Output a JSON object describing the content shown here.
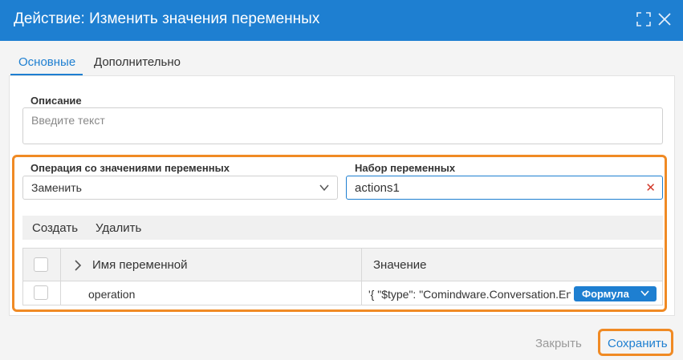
{
  "dialog": {
    "title": "Действие: Изменить значения переменных"
  },
  "tabs": [
    {
      "label": "Основные",
      "active": true
    },
    {
      "label": "Дополнительно",
      "active": false
    }
  ],
  "description": {
    "label": "Описание",
    "placeholder": "Введите текст",
    "value": ""
  },
  "operation": {
    "label": "Операция со значениями переменных",
    "selected": "Заменить"
  },
  "variable_set": {
    "label": "Набор переменных",
    "value": "actions1"
  },
  "toolbar": {
    "create_label": "Создать",
    "delete_label": "Удалить"
  },
  "table": {
    "columns": [
      "Имя переменной",
      "Значение"
    ],
    "rows": [
      {
        "name": "operation",
        "value": "'{ \"$type\": \"Comindware.Conversation.Ent",
        "mode": "Формула"
      }
    ]
  },
  "footer": {
    "close_label": "Закрыть",
    "save_label": "Сохранить"
  },
  "colors": {
    "accent": "#1e7fd1",
    "highlight": "#f08a24",
    "clear_icon": "#d23a2b"
  },
  "icons": [
    "expand-icon",
    "close-icon",
    "chevron-down-icon",
    "clear-icon",
    "chevron-right-icon"
  ]
}
